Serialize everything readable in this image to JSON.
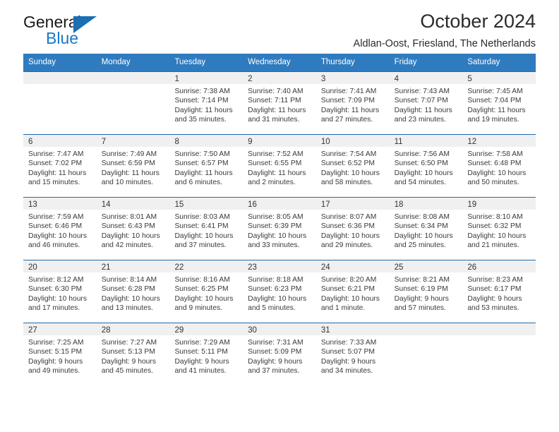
{
  "brand": {
    "name_line1": "General",
    "name_line2": "Blue",
    "logo_icon": "triangle-flag-icon"
  },
  "header": {
    "title": "October 2024",
    "subtitle": "Aldlan-Oost, Friesland, The Netherlands"
  },
  "colors": {
    "header_blue": "#2f7bbf",
    "row_border_blue": "#1e6bb0",
    "day_band_gray": "#f0f0f0",
    "brand_blue": "#1878c8"
  },
  "weekdays": [
    "Sunday",
    "Monday",
    "Tuesday",
    "Wednesday",
    "Thursday",
    "Friday",
    "Saturday"
  ],
  "weeks": [
    [
      {
        "day": "",
        "sunrise": "",
        "sunset": "",
        "daylight": "",
        "empty": true
      },
      {
        "day": "",
        "sunrise": "",
        "sunset": "",
        "daylight": "",
        "empty": true
      },
      {
        "day": "1",
        "sunrise": "Sunrise: 7:38 AM",
        "sunset": "Sunset: 7:14 PM",
        "daylight": "Daylight: 11 hours and 35 minutes."
      },
      {
        "day": "2",
        "sunrise": "Sunrise: 7:40 AM",
        "sunset": "Sunset: 7:11 PM",
        "daylight": "Daylight: 11 hours and 31 minutes."
      },
      {
        "day": "3",
        "sunrise": "Sunrise: 7:41 AM",
        "sunset": "Sunset: 7:09 PM",
        "daylight": "Daylight: 11 hours and 27 minutes."
      },
      {
        "day": "4",
        "sunrise": "Sunrise: 7:43 AM",
        "sunset": "Sunset: 7:07 PM",
        "daylight": "Daylight: 11 hours and 23 minutes."
      },
      {
        "day": "5",
        "sunrise": "Sunrise: 7:45 AM",
        "sunset": "Sunset: 7:04 PM",
        "daylight": "Daylight: 11 hours and 19 minutes."
      }
    ],
    [
      {
        "day": "6",
        "sunrise": "Sunrise: 7:47 AM",
        "sunset": "Sunset: 7:02 PM",
        "daylight": "Daylight: 11 hours and 15 minutes."
      },
      {
        "day": "7",
        "sunrise": "Sunrise: 7:49 AM",
        "sunset": "Sunset: 6:59 PM",
        "daylight": "Daylight: 11 hours and 10 minutes."
      },
      {
        "day": "8",
        "sunrise": "Sunrise: 7:50 AM",
        "sunset": "Sunset: 6:57 PM",
        "daylight": "Daylight: 11 hours and 6 minutes."
      },
      {
        "day": "9",
        "sunrise": "Sunrise: 7:52 AM",
        "sunset": "Sunset: 6:55 PM",
        "daylight": "Daylight: 11 hours and 2 minutes."
      },
      {
        "day": "10",
        "sunrise": "Sunrise: 7:54 AM",
        "sunset": "Sunset: 6:52 PM",
        "daylight": "Daylight: 10 hours and 58 minutes."
      },
      {
        "day": "11",
        "sunrise": "Sunrise: 7:56 AM",
        "sunset": "Sunset: 6:50 PM",
        "daylight": "Daylight: 10 hours and 54 minutes."
      },
      {
        "day": "12",
        "sunrise": "Sunrise: 7:58 AM",
        "sunset": "Sunset: 6:48 PM",
        "daylight": "Daylight: 10 hours and 50 minutes."
      }
    ],
    [
      {
        "day": "13",
        "sunrise": "Sunrise: 7:59 AM",
        "sunset": "Sunset: 6:46 PM",
        "daylight": "Daylight: 10 hours and 46 minutes."
      },
      {
        "day": "14",
        "sunrise": "Sunrise: 8:01 AM",
        "sunset": "Sunset: 6:43 PM",
        "daylight": "Daylight: 10 hours and 42 minutes."
      },
      {
        "day": "15",
        "sunrise": "Sunrise: 8:03 AM",
        "sunset": "Sunset: 6:41 PM",
        "daylight": "Daylight: 10 hours and 37 minutes."
      },
      {
        "day": "16",
        "sunrise": "Sunrise: 8:05 AM",
        "sunset": "Sunset: 6:39 PM",
        "daylight": "Daylight: 10 hours and 33 minutes."
      },
      {
        "day": "17",
        "sunrise": "Sunrise: 8:07 AM",
        "sunset": "Sunset: 6:36 PM",
        "daylight": "Daylight: 10 hours and 29 minutes."
      },
      {
        "day": "18",
        "sunrise": "Sunrise: 8:08 AM",
        "sunset": "Sunset: 6:34 PM",
        "daylight": "Daylight: 10 hours and 25 minutes."
      },
      {
        "day": "19",
        "sunrise": "Sunrise: 8:10 AM",
        "sunset": "Sunset: 6:32 PM",
        "daylight": "Daylight: 10 hours and 21 minutes."
      }
    ],
    [
      {
        "day": "20",
        "sunrise": "Sunrise: 8:12 AM",
        "sunset": "Sunset: 6:30 PM",
        "daylight": "Daylight: 10 hours and 17 minutes."
      },
      {
        "day": "21",
        "sunrise": "Sunrise: 8:14 AM",
        "sunset": "Sunset: 6:28 PM",
        "daylight": "Daylight: 10 hours and 13 minutes."
      },
      {
        "day": "22",
        "sunrise": "Sunrise: 8:16 AM",
        "sunset": "Sunset: 6:25 PM",
        "daylight": "Daylight: 10 hours and 9 minutes."
      },
      {
        "day": "23",
        "sunrise": "Sunrise: 8:18 AM",
        "sunset": "Sunset: 6:23 PM",
        "daylight": "Daylight: 10 hours and 5 minutes."
      },
      {
        "day": "24",
        "sunrise": "Sunrise: 8:20 AM",
        "sunset": "Sunset: 6:21 PM",
        "daylight": "Daylight: 10 hours and 1 minute."
      },
      {
        "day": "25",
        "sunrise": "Sunrise: 8:21 AM",
        "sunset": "Sunset: 6:19 PM",
        "daylight": "Daylight: 9 hours and 57 minutes."
      },
      {
        "day": "26",
        "sunrise": "Sunrise: 8:23 AM",
        "sunset": "Sunset: 6:17 PM",
        "daylight": "Daylight: 9 hours and 53 minutes."
      }
    ],
    [
      {
        "day": "27",
        "sunrise": "Sunrise: 7:25 AM",
        "sunset": "Sunset: 5:15 PM",
        "daylight": "Daylight: 9 hours and 49 minutes."
      },
      {
        "day": "28",
        "sunrise": "Sunrise: 7:27 AM",
        "sunset": "Sunset: 5:13 PM",
        "daylight": "Daylight: 9 hours and 45 minutes."
      },
      {
        "day": "29",
        "sunrise": "Sunrise: 7:29 AM",
        "sunset": "Sunset: 5:11 PM",
        "daylight": "Daylight: 9 hours and 41 minutes."
      },
      {
        "day": "30",
        "sunrise": "Sunrise: 7:31 AM",
        "sunset": "Sunset: 5:09 PM",
        "daylight": "Daylight: 9 hours and 37 minutes."
      },
      {
        "day": "31",
        "sunrise": "Sunrise: 7:33 AM",
        "sunset": "Sunset: 5:07 PM",
        "daylight": "Daylight: 9 hours and 34 minutes."
      },
      {
        "day": "",
        "sunrise": "",
        "sunset": "",
        "daylight": "",
        "empty": true
      },
      {
        "day": "",
        "sunrise": "",
        "sunset": "",
        "daylight": "",
        "empty": true
      }
    ]
  ]
}
